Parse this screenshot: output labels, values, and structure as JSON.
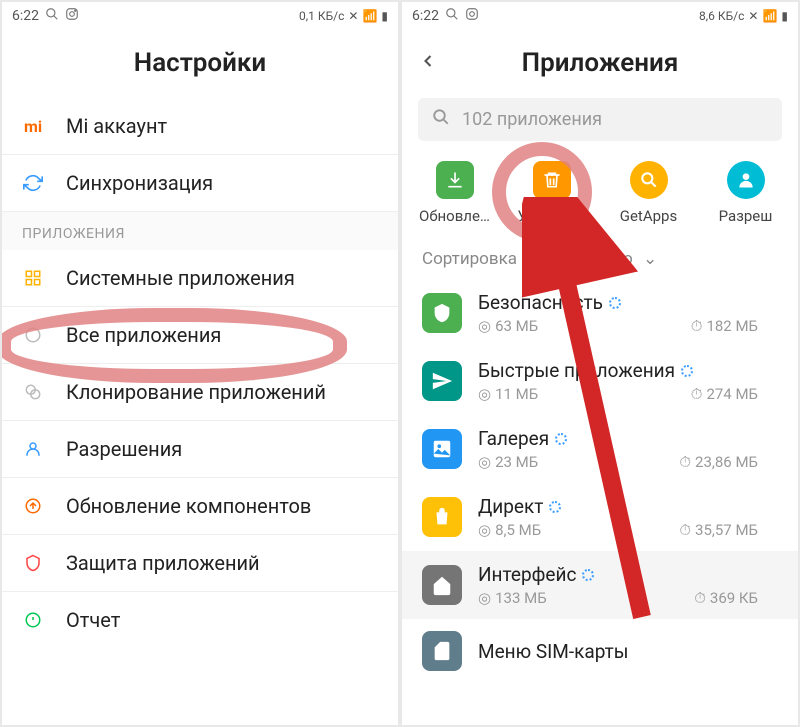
{
  "left": {
    "status": {
      "time": "6:22",
      "speed": "0,1 КБ/с"
    },
    "title": "Настройки",
    "items": [
      {
        "label": "Mi аккаунт",
        "icon": "mi",
        "color": "#ff6900"
      },
      {
        "label": "Синхронизация",
        "icon": "sync",
        "color": "#3b9cff"
      }
    ],
    "section": "ПРИЛОЖЕНИЯ",
    "apps_items": [
      {
        "label": "Системные приложения",
        "icon": "grid",
        "color": "#ffb300"
      },
      {
        "label": "Все приложения",
        "icon": "circle",
        "color": "#bbb"
      },
      {
        "label": "Клонирование приложений",
        "icon": "clone",
        "color": "#bbb"
      },
      {
        "label": "Разрешения",
        "icon": "perm",
        "color": "#3b9cff"
      },
      {
        "label": "Обновление компонентов",
        "icon": "update",
        "color": "#ff6900"
      },
      {
        "label": "Защита приложений",
        "icon": "shield",
        "color": "#ff4444"
      },
      {
        "label": "Отчет",
        "icon": "report",
        "color": "#00c853"
      }
    ]
  },
  "right": {
    "status": {
      "time": "6:22",
      "speed": "8,6 КБ/с"
    },
    "title": "Приложения",
    "search_placeholder": "102 приложения",
    "actions": [
      {
        "label": "Обновле…",
        "color": "#4caf50"
      },
      {
        "label": "Удаление",
        "color": "#ff9800"
      },
      {
        "label": "GetApps",
        "color": "#ffb300"
      },
      {
        "label": "Разреш",
        "color": "#00bcd4"
      }
    ],
    "sort_label": "Сортировка по состоянию",
    "apps": [
      {
        "name": "Безопасность",
        "storage": "63 МБ",
        "time": "182 МБ",
        "color": "#4caf50"
      },
      {
        "name": "Быстрые приложения",
        "storage": "11 МБ",
        "time": "274 МБ",
        "color": "#009688"
      },
      {
        "name": "Галерея",
        "storage": "23 МБ",
        "time": "23,86 МБ",
        "color": "#2196f3"
      },
      {
        "name": "Директ",
        "storage": "8,5 МБ",
        "time": "35,57 МБ",
        "color": "#ffc107"
      },
      {
        "name": "Интерфейс",
        "storage": "133 МБ",
        "time": "369 КБ",
        "color": "#757575"
      },
      {
        "name": "Меню SIM-карты",
        "storage": "",
        "time": "",
        "color": "#607d8b"
      }
    ]
  }
}
